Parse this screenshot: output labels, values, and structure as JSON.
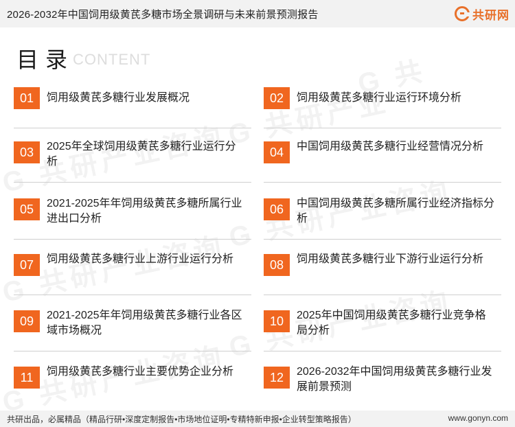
{
  "header": {
    "title": "2026-2032年中国饲用级黄芪多糖市场全景调研与未来前景预测报告",
    "logo_text": "共研网"
  },
  "toc": {
    "heading": "目录",
    "heading_en": "CONTENT",
    "items": [
      {
        "num": "01",
        "label": "饲用级黄芪多糖行业发展概况"
      },
      {
        "num": "02",
        "label": "饲用级黄芪多糖行业运行环境分析"
      },
      {
        "num": "03",
        "label": "2025年全球饲用级黄芪多糖行业运行分析"
      },
      {
        "num": "04",
        "label": "中国饲用级黄芪多糖行业经营情况分析"
      },
      {
        "num": "05",
        "label": "2021-2025年年饲用级黄芪多糖所属行业进出口分析"
      },
      {
        "num": "06",
        "label": "中国饲用级黄芪多糖所属行业经济指标分析"
      },
      {
        "num": "07",
        "label": "饲用级黄芪多糖行业上游行业运行分析"
      },
      {
        "num": "08",
        "label": "饲用级黄芪多糖行业下游行业运行分析"
      },
      {
        "num": "09",
        "label": "2021-2025年年饲用级黄芪多糖行业各区域市场概况"
      },
      {
        "num": "10",
        "label": "2025年中国饲用级黄芪多糖行业竞争格局分析"
      },
      {
        "num": "11",
        "label": "饲用级黄芪多糖行业主要优势企业分析"
      },
      {
        "num": "12",
        "label": "2026-2032年中国饲用级黄芪多糖行业发展前景预测"
      }
    ]
  },
  "footer": {
    "left": "共研出品，必属精品（精品行研•深度定制报告•市场地位证明•专精特新申报•企业转型策略报告）",
    "right": "www.gonyn.com"
  },
  "colors": {
    "accent": "#f0661f",
    "bar": "#f2f2f2"
  }
}
